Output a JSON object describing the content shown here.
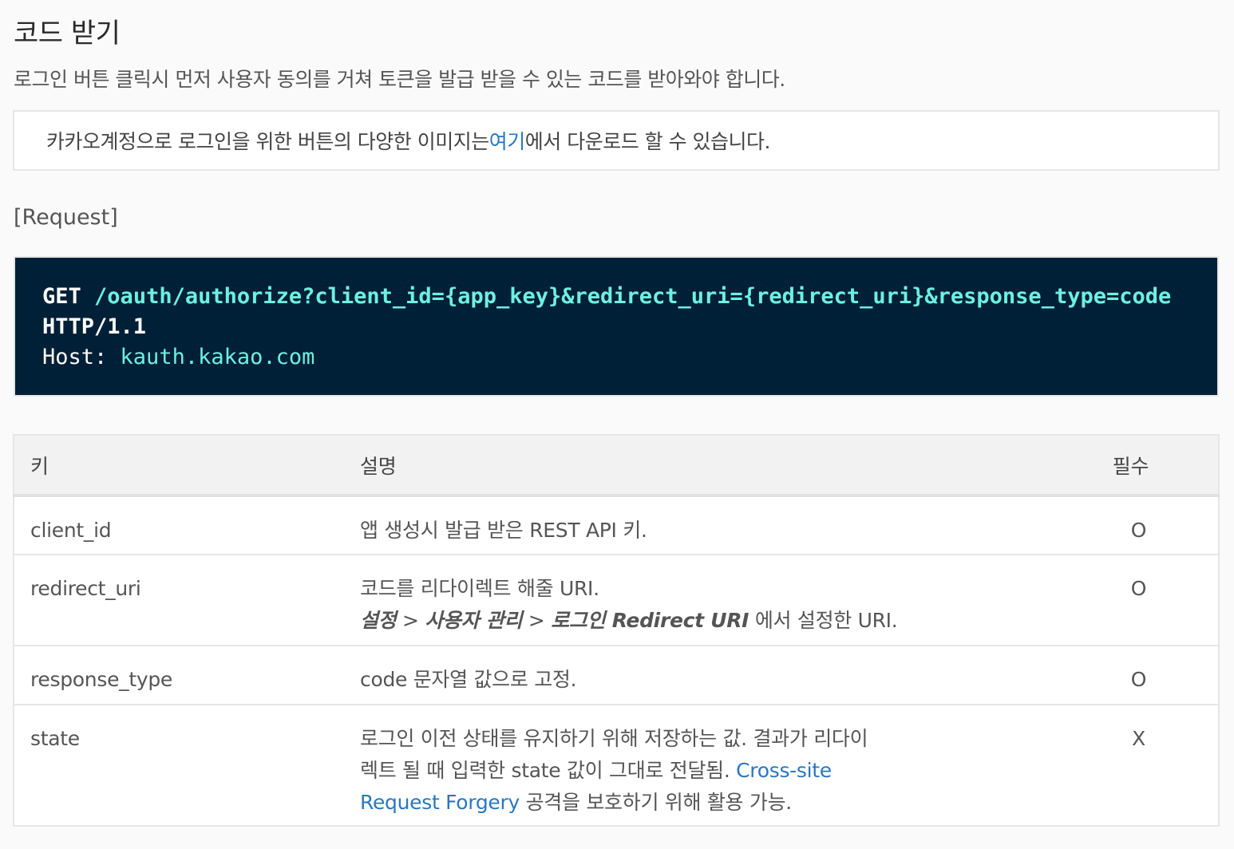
{
  "heading": {
    "title": "코드 받기",
    "description": "로그인 버튼 클릭시 먼저 사용자 동의를 거쳐 토큰을 발급 받을 수 있는 코드를 받아와야 합니다."
  },
  "note": {
    "text_before": "카카오계정으로 로그인을 위한 버튼의 다양한 이미지는 ",
    "link_text": "여기",
    "text_after": "에서 다운로드 할 수 있습니다."
  },
  "request": {
    "label": "[Request]",
    "method": "GET",
    "path": "/oauth/authorize?client_id={app_key}&redirect_uri={redirect_uri}&response_type=code",
    "protocol": "HTTP/1.1",
    "host_key": "Host:",
    "host_value": "kauth.kakao.com"
  },
  "table": {
    "headers": {
      "key": "키",
      "description": "설명",
      "required": "필수"
    },
    "rows": [
      {
        "key": "client_id",
        "description": "앱 생성시 발급 받은 REST API 키.",
        "required": "O"
      },
      {
        "key": "redirect_uri",
        "description": "코드를 리다이렉트 해줄 URI.",
        "description_path_1": "설정",
        "description_sep_1": " > ",
        "description_path_2": "사용자 관리",
        "description_sep_2": " > ",
        "description_path_3": "로그인 Redirect URI",
        "description_path_suffix": " 에서 설정한 URI.",
        "required": "O"
      },
      {
        "key": "response_type",
        "description": "code 문자열 값으로 고정.",
        "required": "O"
      },
      {
        "key": "state",
        "description_before": "로그인 이전 상태를 유지하기 위해 저장하는 값. 결과가 리다이렉트 될 때 입력한 state 값이 그대로 전달됨. ",
        "description_link": "Cross-site Request Forgery",
        "description_after": " 공격을 보호하기 위해 활용 가능.",
        "required": "X"
      }
    ]
  }
}
